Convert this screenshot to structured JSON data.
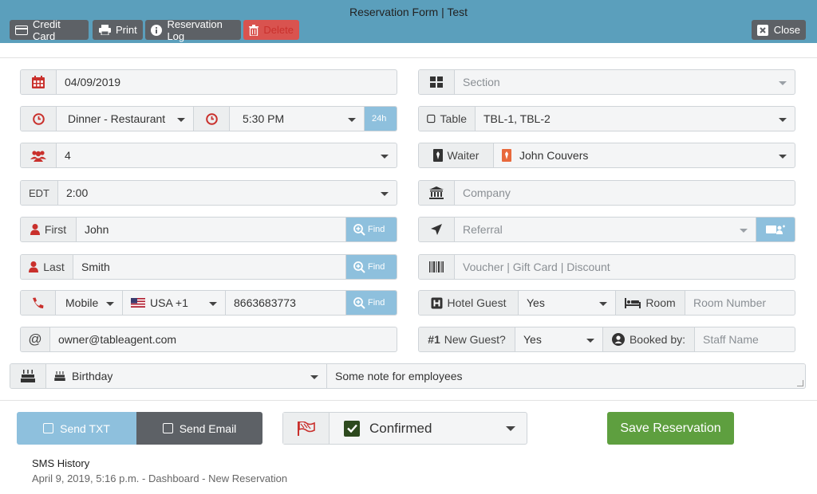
{
  "header": {
    "title": "Reservation Form | Test",
    "buttons": {
      "credit_card": "Credit Card",
      "print": "Print",
      "reservation_log": "Reservation Log",
      "delete": "Delete",
      "close": "Close"
    }
  },
  "form": {
    "date": "04/09/2019",
    "section_placeholder": "Section",
    "meal": "Dinner - Restaurant",
    "time": "5:30 PM",
    "time_format_label": "24h",
    "table_label": "Table",
    "table_value": "TBL-1, TBL-2",
    "party_size": "4",
    "waiter_label": "Waiter",
    "waiter_value": "John Couvers",
    "timezone_label": "EDT",
    "duration": "2:00",
    "company_placeholder": "Company",
    "first_label": "First",
    "first_value": "John",
    "find_label": "Find",
    "referral_placeholder": "Referral",
    "last_label": "Last",
    "last_value": "Smith",
    "voucher_placeholder": "Voucher | Gift Card | Discount",
    "phone_type": "Mobile",
    "country_code": "USA +1",
    "phone": "8663683773",
    "hotel_guest_label": "Hotel Guest",
    "hotel_guest_value": "Yes",
    "room_label": "Room",
    "room_placeholder": "Room Number",
    "email": "owner@tableagent.com",
    "new_guest_label": "New Guest?",
    "new_guest_prefix": "#1",
    "new_guest_value": "Yes",
    "booked_by_label": "Booked by:",
    "staff_placeholder": "Staff Name",
    "occasion": "Birthday",
    "note": "Some note for employees"
  },
  "footer": {
    "send_txt": "Send TXT",
    "send_email": "Send Email",
    "status": "Confirmed",
    "save": "Save Reservation",
    "sms_history_title": "SMS History",
    "sms_history_entry": "April 9, 2019, 5:16 p.m. - Dashboard - New Reservation"
  },
  "colors": {
    "header": "#5b9fbc",
    "accent_blue": "#8ec0dd",
    "danger": "#d9534f",
    "success": "#5e9f3f",
    "dark": "#5d6166"
  }
}
